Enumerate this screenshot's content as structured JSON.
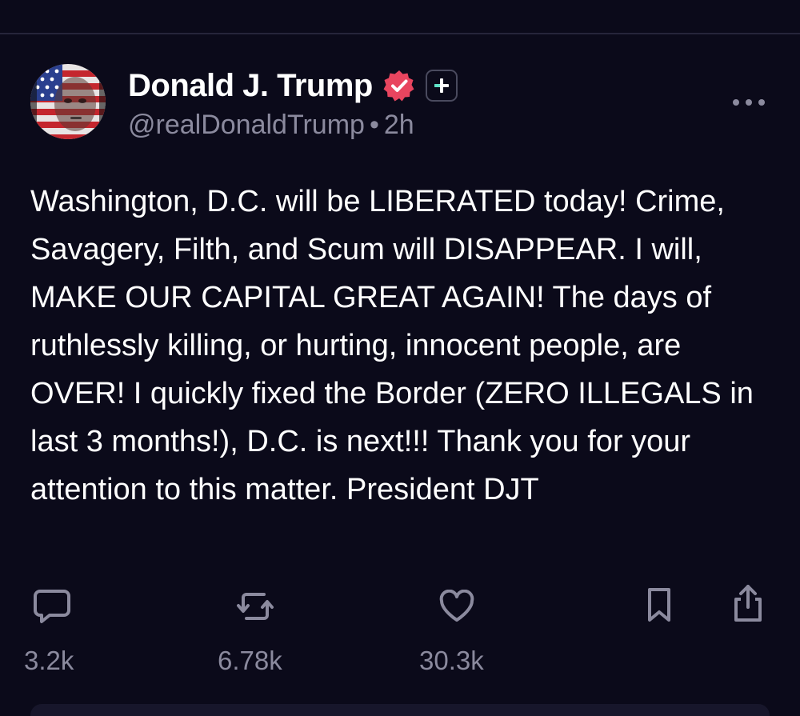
{
  "post": {
    "author": {
      "display_name": "Donald J. Trump",
      "handle": "@realDonaldTrump",
      "separator": "•",
      "timestamp": "2h",
      "avatar": "avatar-flag-portrait",
      "verified_icon": "verified-badge-icon",
      "plus_icon": "plus-badge-icon"
    },
    "body": "Washington, D.C. will be LIBERATED today! Crime, Savagery, Filth, and Scum will DISAPPEAR. I will, MAKE OUR CAPITAL GREAT AGAIN! The days of ruthlessly killing, or hurting, innocent people, are OVER! I quickly fixed the Border (ZERO ILLEGALS in last 3 months!), D.C. is next!!! Thank you for your attention to this matter. President DJT",
    "more_icon": "more-horizontal-icon",
    "actions": {
      "replies": {
        "icon": "reply-icon",
        "count": "3.2k"
      },
      "reposts": {
        "icon": "repost-icon",
        "count": "6.78k"
      },
      "likes": {
        "icon": "heart-icon",
        "count": "30.3k"
      },
      "bookmark": {
        "icon": "bookmark-icon"
      },
      "share": {
        "icon": "share-icon"
      }
    }
  },
  "colors": {
    "background": "#0b0a1a",
    "text_primary": "#ffffff",
    "text_secondary": "#8b8a9e",
    "verified_badge": "#e8455f",
    "plus_accent": "#5fe3c8"
  }
}
